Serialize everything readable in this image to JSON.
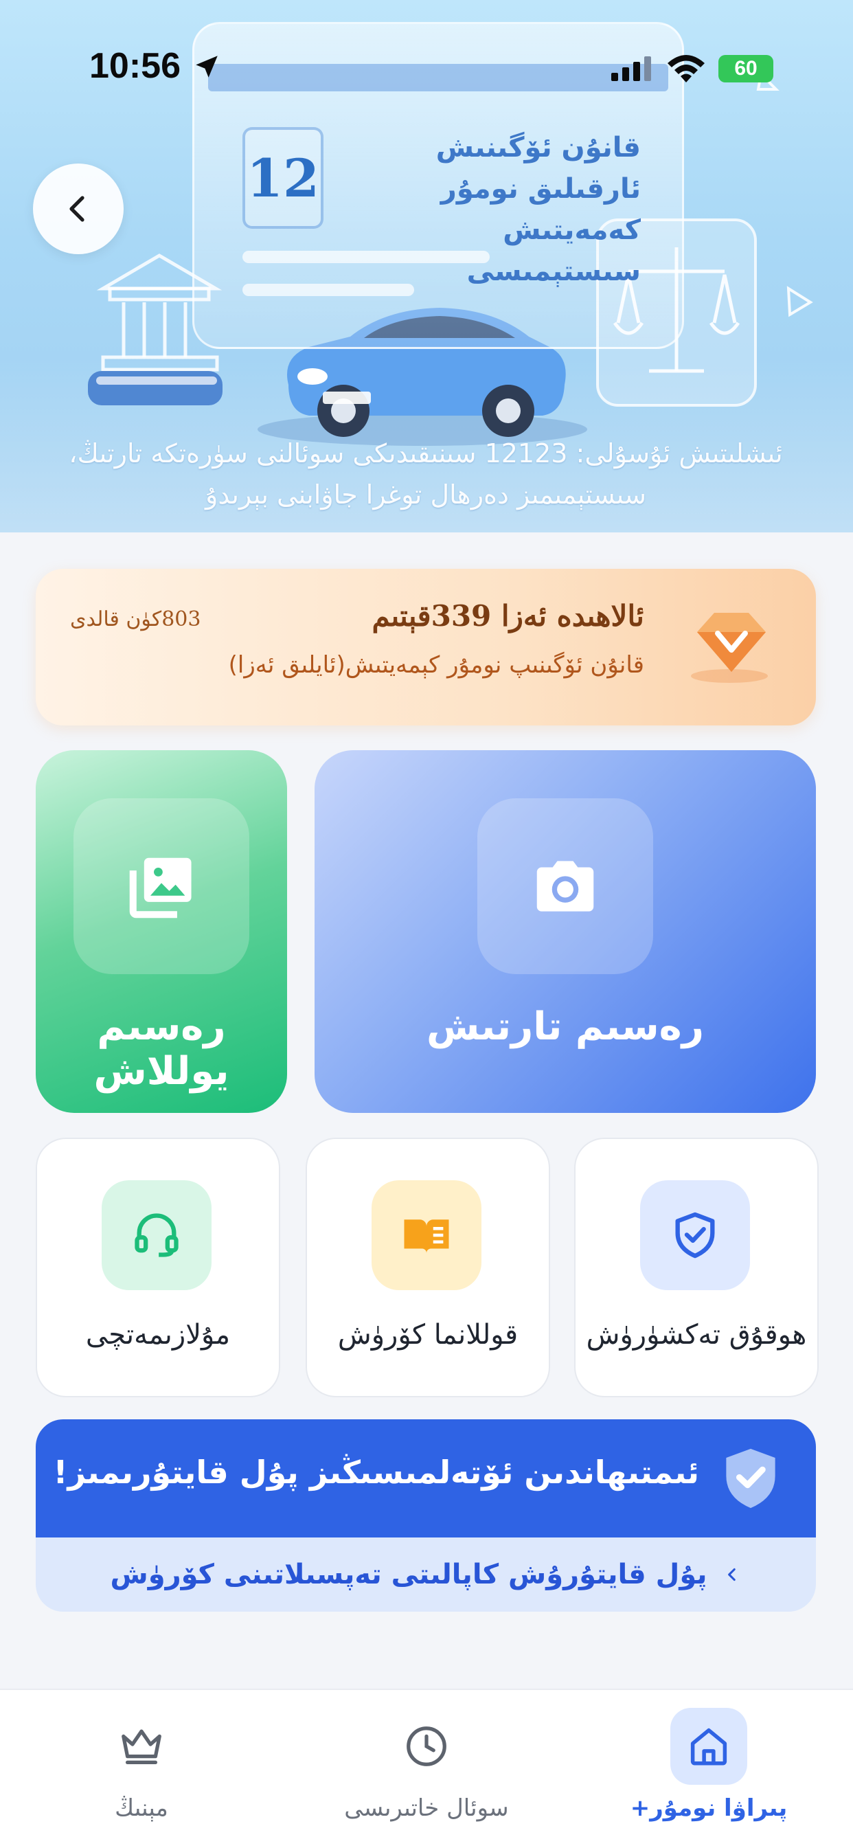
{
  "status_bar": {
    "time": "10:56",
    "battery": "60"
  },
  "hero": {
    "card_number": "12",
    "card_title": "قانۇن ئۆگىنىش ئارقىلىق نومۇر كەمەيتىش سىستېمىسى",
    "caption": "ئىشلىتىش ئۇسۇلى: 12123 سىنىقىدىكى سوئالنى سۈرەتكە تارتىڭ، سىستېمىمىز دەرھال توغرا جاۋابنى بېرىدۇ"
  },
  "vip": {
    "title": "ئالاھىدە ئەزا 339قېتىم",
    "subtitle": "قانۇن ئۆگىنىپ نومۇر كېمەيتىش(ئايلىق ئەزا)",
    "days_left": "803كۈن قالدى",
    "accent_color": "#f08a3c"
  },
  "actions": {
    "take_photo": "رەسىم تارتىش",
    "upload_photo": "رەسىم يوللاش"
  },
  "cards": {
    "rights": {
      "label": "ھوقۇق تەكشۈرۈش",
      "icon": "shield-check-icon"
    },
    "guide": {
      "label": "قوللانما كۆرۈش",
      "icon": "book-icon"
    },
    "support": {
      "label": "مۇلازىمەتچى",
      "icon": "headset-icon"
    }
  },
  "insurance": {
    "title": "ئىمتىھاندىن ئۆتەلمىسىڭىز پۇل قايتۇرىمىز!",
    "link": "پۇل قايتۇرۇش كاپالىتى تەپسىلاتىنى كۆرۈش",
    "color": "#2f63e4"
  },
  "tabbar": {
    "home": "پىراۋا نومۇر+",
    "history": "سوئال خاتىرىسى",
    "mine": "مېنىڭ"
  }
}
